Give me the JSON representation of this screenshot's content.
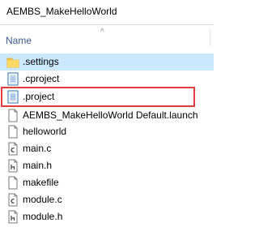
{
  "window": {
    "title": "AEMBS_MakeHelloWorld"
  },
  "header": {
    "name_label": "Name",
    "sort": "ascending"
  },
  "colors": {
    "selected_row": "#cce8ff",
    "highlight": "#e03c3c",
    "folder": "#f5c445",
    "header_text": "#3c5a8c"
  },
  "files": [
    {
      "name": ".settings",
      "icon": "folder-icon",
      "selected": true
    },
    {
      "name": ".cproject",
      "icon": "document-icon",
      "selected": false
    },
    {
      "name": ".project",
      "icon": "document-icon",
      "selected": false,
      "highlighted": true
    },
    {
      "name": "AEMBS_MakeHelloWorld Default.launch",
      "icon": "blank-file-icon",
      "selected": false
    },
    {
      "name": "helloworld",
      "icon": "blank-file-icon",
      "selected": false
    },
    {
      "name": "main.c",
      "icon": "c-source-file-icon",
      "selected": false
    },
    {
      "name": "main.h",
      "icon": "header-file-icon",
      "selected": false
    },
    {
      "name": "makefile",
      "icon": "blank-file-icon",
      "selected": false
    },
    {
      "name": "module.c",
      "icon": "c-source-file-icon",
      "selected": false
    },
    {
      "name": "module.h",
      "icon": "header-file-icon",
      "selected": false
    }
  ]
}
